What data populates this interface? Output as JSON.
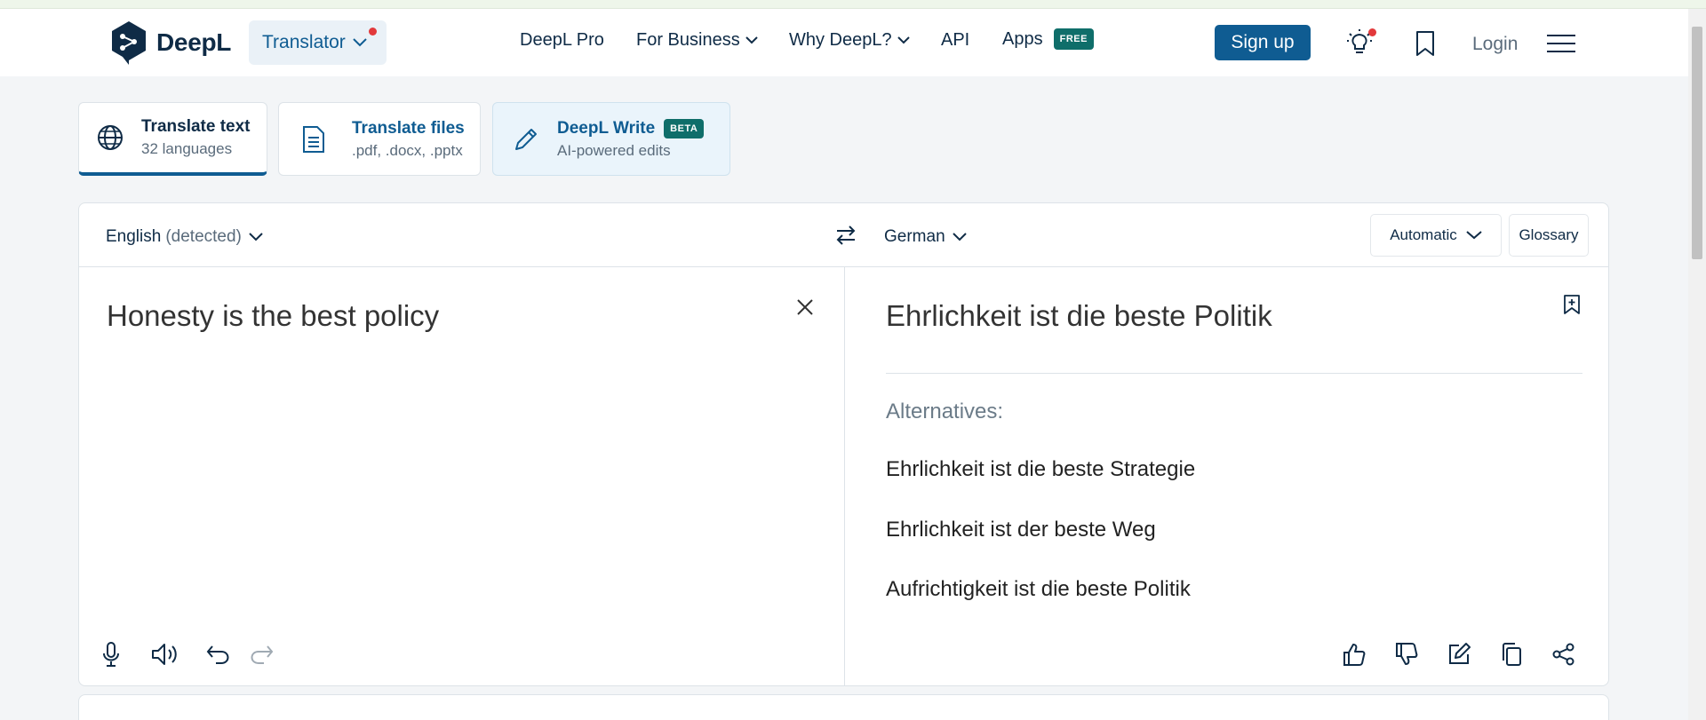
{
  "header": {
    "logo_text": "DeepL",
    "translator_label": "Translator",
    "nav": {
      "deepl_pro": "DeepL Pro",
      "for_business": "For Business",
      "why_deepl": "Why DeepL?",
      "api": "API",
      "apps": "Apps",
      "apps_badge": "FREE"
    },
    "signup_label": "Sign up",
    "login_label": "Login"
  },
  "modes": [
    {
      "title": "Translate text",
      "subtitle": "32 languages"
    },
    {
      "title": "Translate files",
      "subtitle": ".pdf, .docx, .pptx"
    },
    {
      "title": "DeepL Write",
      "badge": "BETA",
      "subtitle": "AI-powered edits"
    }
  ],
  "translator": {
    "source_lang": "English",
    "source_lang_note": "(detected)",
    "target_lang": "German",
    "formality": "Automatic",
    "glossary": "Glossary",
    "source_text": "Honesty is the best policy",
    "target_text": "Ehrlichkeit ist die beste Politik",
    "alternatives_label": "Alternatives:",
    "alternatives": [
      "Ehrlichkeit ist die beste Strategie",
      "Ehrlichkeit ist der beste Weg",
      "Aufrichtigkeit ist die beste Politik"
    ]
  },
  "colors": {
    "brand_dark": "#0f2b46",
    "brand_blue": "#0f5c92",
    "badge_teal": "#0f6e6a",
    "notification_red": "#e2393b"
  }
}
